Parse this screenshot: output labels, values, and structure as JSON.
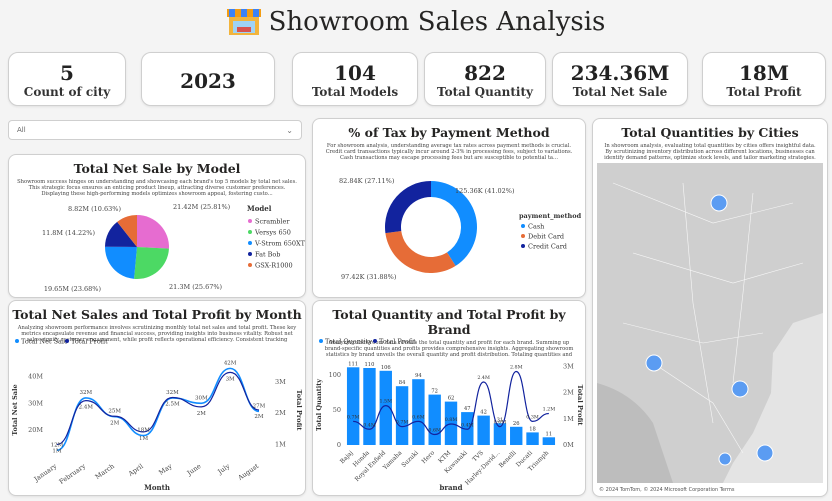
{
  "header": {
    "title": "Showroom Sales Analysis",
    "icon": "showroom-icon"
  },
  "kpis": [
    {
      "value": "5",
      "label": "Count of city"
    },
    {
      "value": "2023",
      "label": ""
    },
    {
      "value": "104",
      "label": "Total Models"
    },
    {
      "value": "822",
      "label": "Total Quantity"
    },
    {
      "value": "234.36M",
      "label": "Total Net Sale"
    },
    {
      "value": "18M",
      "label": "Total Profit"
    }
  ],
  "slicer": {
    "value": "All"
  },
  "pie_card": {
    "title": "Total Net Sale by Model",
    "desc": "Showroom success hinges on understanding and showcasing each brand's top 5 models by total net sales. This strategic focus ensures an enticing product lineup, attracting diverse customer preferences. Displaying these high-performing models optimizes showroom appeal, fostering custo..."
  },
  "tax_card": {
    "title": "% of Tax by Payment Method",
    "desc": "For showroom analysis, understanding average tax rates across payment methods is crucial. Credit card transactions typically incur around 2-3% in processing fees, subject to variations. Cash transactions may escape processing fees but are susceptible to potential ta..."
  },
  "map_card": {
    "title": "Total Quantities by Cities",
    "desc": "In showroom analysis, evaluating total quantities by cities offers insightful data. By scrutinizing inventory distribution across different locations, businesses can identify demand patterns, optimize stock levels, and tailor marketing strategies. This granula...",
    "footer": "© 2024 TomTom, © 2024 Microsoft Corporation  Terms"
  },
  "month_card": {
    "title": "Total Net Sales and Total Profit by Month",
    "desc": "Analyzing showroom performance involves scrutinizing monthly total net sales and total profit. These key metrics encapsulate revenue and financial success, providing insights into business vitality. Robust net sales signify customer engagement, while profit reflects operational efficiency. Consistent tracking enables strategi..."
  },
  "brand_card": {
    "title": "Total Quantity and Total Profit by Brand",
    "desc": "Analyzing showroom data reveals the total quantity and profit for each brand. Summing up brand-specific quantities and profits provides comprehensive insights. Aggregating showroom statistics by brand unveils the overall quantity and profit distribution. Totaling quantities and profit..."
  },
  "colors": {
    "teal": "#1aa6a6",
    "blue": "#118dff",
    "navy": "#12239e",
    "orange": "#e66c37",
    "pink": "#e044a7",
    "green": "#2ecc71",
    "darkblue": "#12239e",
    "bar": "#118dff",
    "line": "#12239e"
  },
  "chart_data": [
    {
      "type": "pie",
      "title": "Total Net Sale by Model",
      "legend_title": "Model",
      "legend_position": "right",
      "slices": [
        {
          "name": "Scrambler",
          "value": 21.42,
          "label": "21.42M (25.81%)",
          "color": "#e66cd0"
        },
        {
          "name": "Versys 650",
          "value": 21.3,
          "label": "21.3M (25.67%)",
          "color": "#4cd964"
        },
        {
          "name": "V-Strom 650XT",
          "value": 19.65,
          "label": "19.65M (23.68%)",
          "color": "#118dff"
        },
        {
          "name": "Fat Bob",
          "value": 11.8,
          "label": "11.8M (14.22%)",
          "color": "#12239e"
        },
        {
          "name": "GSX-R1000",
          "value": 8.82,
          "label": "8.82M (10.63%)",
          "color": "#e66c37"
        }
      ]
    },
    {
      "type": "pie",
      "subtype": "donut",
      "title": "% of Tax by Payment Method",
      "legend_title": "payment_method",
      "legend_position": "right",
      "slices": [
        {
          "name": "Cash",
          "value": 125.36,
          "label": "125.36K (41.02%)",
          "color": "#118dff"
        },
        {
          "name": "Debit Card",
          "value": 97.42,
          "label": "97.42K (31.88%)",
          "color": "#e66c37"
        },
        {
          "name": "Credit Card",
          "value": 82.84,
          "label": "82.84K (27.11%)",
          "color": "#12239e"
        }
      ]
    },
    {
      "type": "line",
      "title": "Total Net Sales and Total Profit by Month",
      "xlabel": "Month",
      "ylabel": "Total Net Sale",
      "y2label": "Total Profit",
      "categories": [
        "January",
        "February",
        "March",
        "April",
        "May",
        "June",
        "July",
        "August"
      ],
      "yticks": [
        "40M",
        "30M",
        "20M"
      ],
      "y2ticks": [
        "3M",
        "2M",
        "1M"
      ],
      "ylim": [
        10,
        45
      ],
      "y2lim": [
        0.6,
        3.6
      ],
      "series": [
        {
          "name": "Total Net Sale",
          "axis": "left",
          "values": [
            12.5,
            32,
            25,
            18,
            32,
            30,
            43,
            27
          ],
          "labels": [
            "12M",
            "32M",
            "25M",
            "18M",
            "32M",
            "30M",
            "42M",
            "27M"
          ]
        },
        {
          "name": "Total Profit",
          "axis": "right",
          "values": [
            1.0,
            2.4,
            1.9,
            1.4,
            2.5,
            2.2,
            3.3,
            2.1
          ],
          "labels": [
            "1M",
            "2.4M",
            "2M",
            "1M",
            "2.5M",
            "2M",
            "3M",
            "2M"
          ]
        }
      ],
      "legend_position": "top-left"
    },
    {
      "type": "bar",
      "title": "Total Quantity and Total Profit by Brand",
      "xlabel": "brand",
      "ylabel": "Total Quantity",
      "y2label": "Total Profit",
      "categories": [
        "Bajaj",
        "Honda",
        "Royal Enfield",
        "Yamaha",
        "Suzuki",
        "Hero",
        "KTM",
        "Kawasaki",
        "TVS",
        "Harley-David...",
        "Benelli",
        "Ducati",
        "Triumph"
      ],
      "yticks": [
        "100",
        "50",
        "0"
      ],
      "y2ticks": [
        "3M",
        "2M",
        "1M",
        "0M"
      ],
      "ylim": [
        0,
        120
      ],
      "y2lim": [
        0,
        3.2
      ],
      "series": [
        {
          "name": "Total Quantity",
          "type": "bar",
          "values": [
            111,
            110,
            106,
            84,
            94,
            72,
            62,
            47,
            42,
            31,
            26,
            18,
            11
          ],
          "labels": [
            "111",
            "110",
            "106",
            "84",
            "94",
            "72",
            "62",
            "47",
            "42",
            "31",
            "26",
            "18",
            "11"
          ]
        },
        {
          "name": "Total Profit",
          "type": "line",
          "values": [
            0.9,
            0.6,
            1.5,
            0.7,
            0.9,
            0.4,
            0.8,
            0.6,
            2.4,
            0.7,
            2.8,
            0.9,
            1.2
          ],
          "labels": [
            "0.7M",
            "0.4M",
            "1.5M",
            "0.7M",
            "0.6M",
            "0.6M",
            "0.8M",
            "0.4M",
            "2.4M",
            "0.6M",
            "2.8M",
            "0.3M",
            "1.2M"
          ]
        }
      ],
      "legend_position": "top-left"
    },
    {
      "type": "map",
      "title": "Total Quantities by Cities",
      "bubbles": 5
    }
  ]
}
